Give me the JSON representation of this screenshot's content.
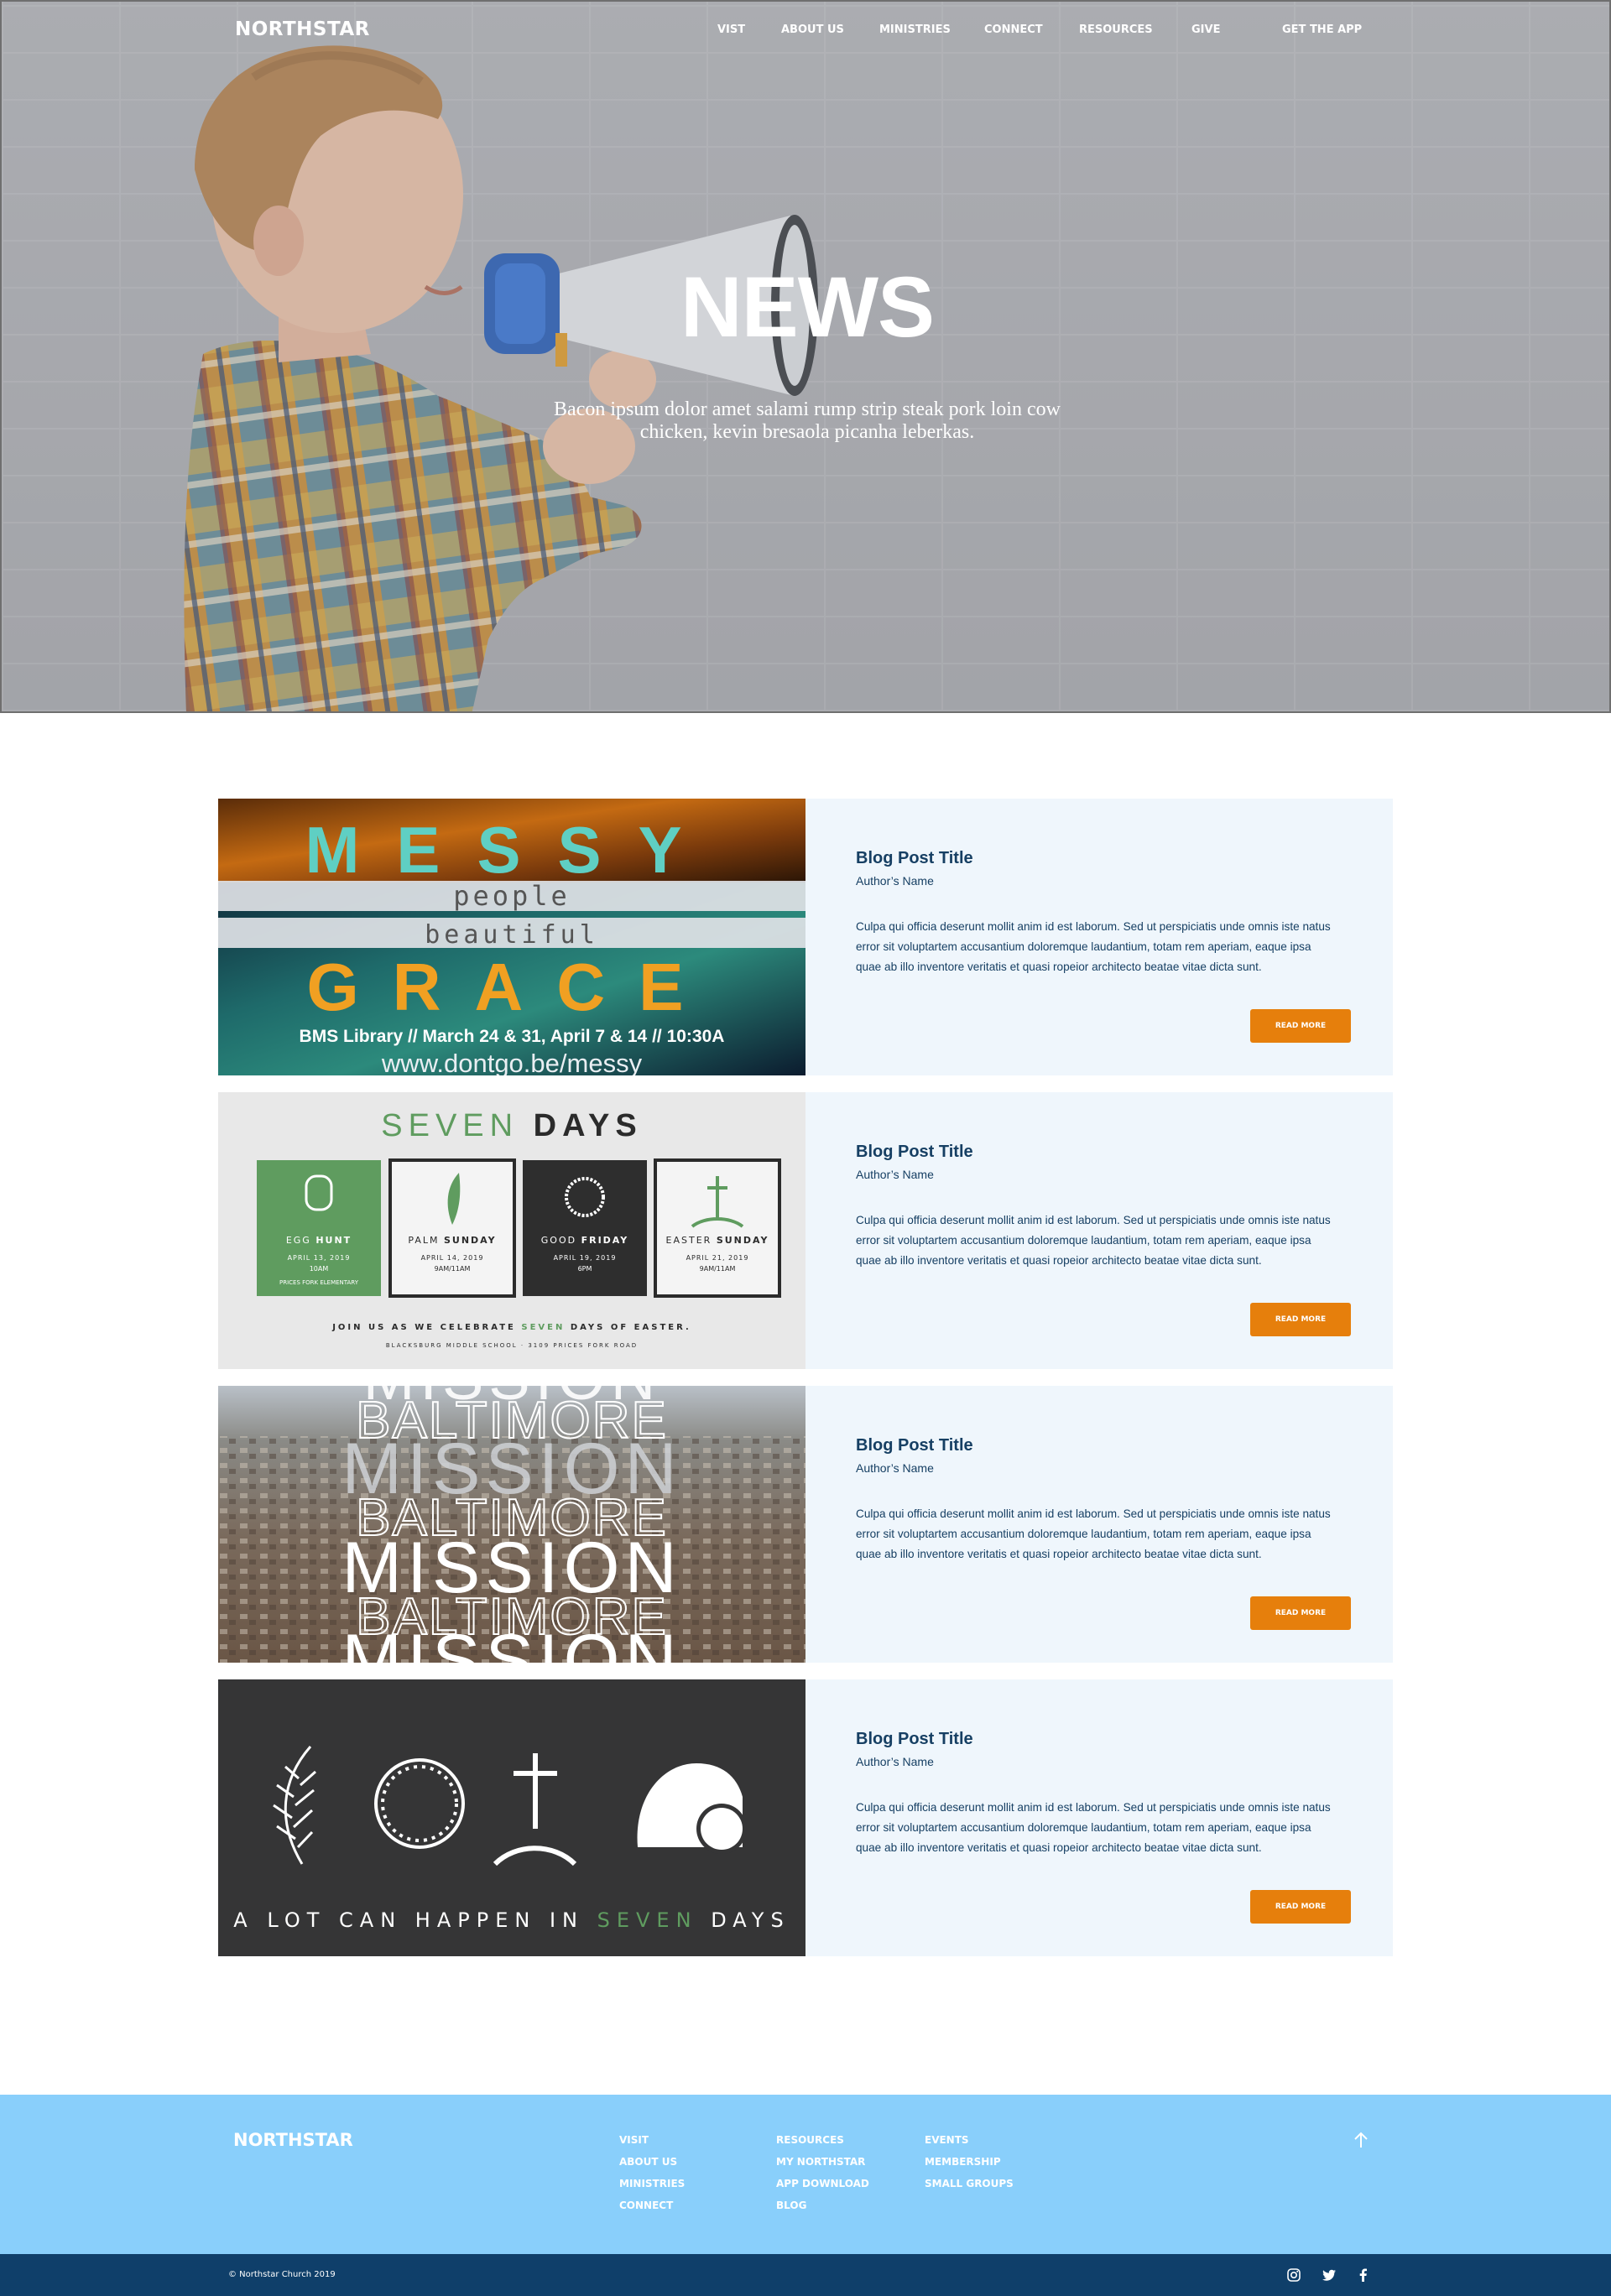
{
  "nav": {
    "brand": "NORTHSTAR",
    "items": [
      {
        "label": "VIST"
      },
      {
        "label": "ABOUT US"
      },
      {
        "label": "MINISTRIES"
      },
      {
        "label": "CONNECT"
      },
      {
        "label": "RESOURCES"
      },
      {
        "label": "GIVE"
      }
    ],
    "cta": "GET THE APP"
  },
  "hero": {
    "title": "NEWS",
    "subtitle": "Bacon ipsum dolor amet salami rump strip steak pork loin cow chicken, kevin bresaola picanha leberkas."
  },
  "posts": [
    {
      "title": "Blog Post Title",
      "author": "Author’s Name",
      "body": "Culpa qui officia deserunt mollit anim id est laborum. Sed ut perspiciatis unde omnis iste natus error sit voluptartem accusantium doloremque laudantium, totam rem aperiam, eaque ipsa quae ab illo inventore veritatis et quasi ropeior architecto beatae vitae dicta sunt.",
      "button": "READ MORE",
      "image": {
        "word1": "MESSY",
        "word2": "people",
        "word3": "beautiful",
        "word4": "GRACE",
        "details": "BMS Library // March 24 & 31, April 7 & 14 // 10:30A",
        "url": "www.dontgo.be/messy"
      }
    },
    {
      "title": "Blog Post Title",
      "author": "Author’s Name",
      "body": "Culpa qui officia deserunt mollit anim id est laborum. Sed ut perspiciatis unde omnis iste natus error sit voluptartem accusantium doloremque laudantium, totam rem aperiam, eaque ipsa quae ab illo inventore veritatis et quasi ropeior architecto beatae vitae dicta sunt.",
      "button": "READ MORE",
      "image": {
        "heading_a": "SEVEN",
        "heading_b": "DAYS",
        "events": [
          {
            "name_a": "EGG",
            "name_b": "HUNT",
            "date": "APRIL 13, 2019",
            "time": "10AM",
            "place": "PRICES FORK ELEMENTARY"
          },
          {
            "name_a": "PALM",
            "name_b": "SUNDAY",
            "date": "APRIL 14, 2019",
            "time": "9AM/11AM",
            "place": ""
          },
          {
            "name_a": "GOOD",
            "name_b": "FRIDAY",
            "date": "APRIL 19, 2019",
            "time": "6PM",
            "place": ""
          },
          {
            "name_a": "EASTER",
            "name_b": "SUNDAY",
            "date": "APRIL 21, 2019",
            "time": "9AM/11AM",
            "place": ""
          }
        ],
        "footer_a": "JOIN US AS WE CELEBRATE",
        "footer_b": "SEVEN",
        "footer_c": "DAYS OF EASTER.",
        "location": "BLACKSBURG MIDDLE SCHOOL · 3109 PRICES FORK ROAD"
      }
    },
    {
      "title": "Blog Post Title",
      "author": "Author’s Name",
      "body": "Culpa qui officia deserunt mollit anim id est laborum. Sed ut perspiciatis unde omnis iste natus error sit voluptartem accusantium doloremque laudantium, totam rem aperiam, eaque ipsa quae ab illo inventore veritatis et quasi ropeior architecto beatae vitae dicta sunt.",
      "button": "READ MORE",
      "image": {
        "word_a": "MISSION",
        "word_b": "BALTIMORE"
      }
    },
    {
      "title": "Blog Post Title",
      "author": "Author’s Name",
      "body": "Culpa qui officia deserunt mollit anim id est laborum. Sed ut perspiciatis unde omnis iste natus error sit voluptartem accusantium doloremque laudantium, totam rem aperiam, eaque ipsa quae ab illo inventore veritatis et quasi ropeior architecto beatae vitae dicta sunt.",
      "button": "READ MORE",
      "image": {
        "caption_a": "A LOT CAN HAPPEN IN",
        "caption_b": "SEVEN",
        "caption_c": "DAYS"
      }
    }
  ],
  "footer": {
    "brand": "NORTHSTAR",
    "columns": [
      [
        "VISIT",
        "ABOUT US",
        "MINISTRIES",
        "CONNECT"
      ],
      [
        "RESOURCES",
        "MY NORTHSTAR",
        "APP DOWNLOAD",
        "BLOG"
      ],
      [
        "EVENTS",
        "MEMBERSHIP",
        "SMALL GROUPS"
      ]
    ],
    "copyright": "© Northstar Church 2019",
    "social_icons": [
      "instagram-icon",
      "twitter-icon",
      "facebook-icon"
    ]
  },
  "colors": {
    "accent": "#e67f0c",
    "heading_blue": "#163f63",
    "card_bg": "#eff6fc",
    "footer_bg": "#89cffb",
    "sub_footer_bg": "#0f3f6a",
    "seven_green": "#5f9c5f"
  }
}
